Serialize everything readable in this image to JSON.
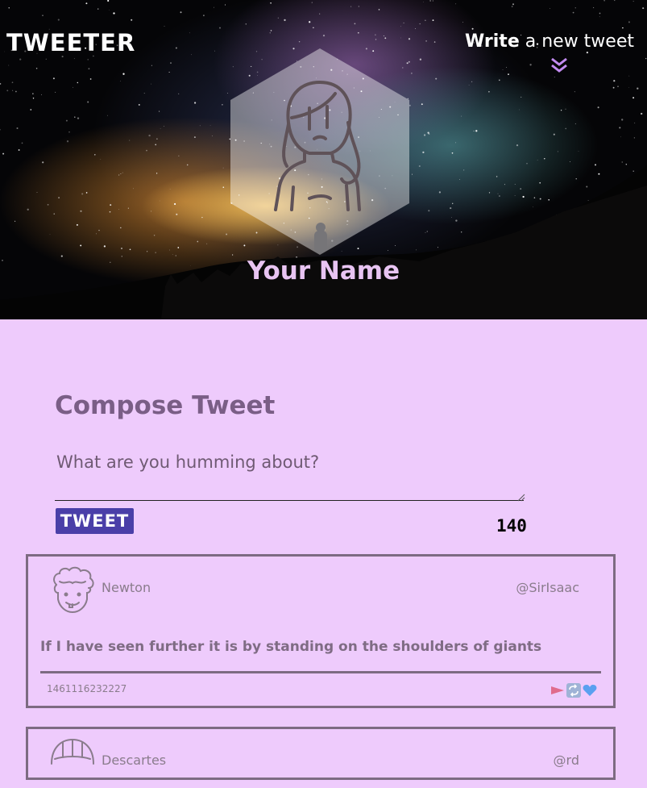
{
  "brand": "TWEETER",
  "nav": {
    "write_bold": "Write",
    "write_rest": " a new tweet",
    "chevron_icon": "double-chevron-down-icon"
  },
  "profile": {
    "name": "Your Name",
    "avatar_icon": "user-avatar-icon"
  },
  "compose": {
    "title": "Compose Tweet",
    "placeholder": "What are you humming about?",
    "button_label": "TWEET",
    "counter": "140"
  },
  "tweets": [
    {
      "name": "Newton",
      "handle": "@SirIsaac",
      "content": "If I have seen further it is by standing on the shoulders of giants",
      "timestamp": "1461116232227",
      "actions": [
        "flag-icon",
        "retweet-icon",
        "heart-icon"
      ]
    },
    {
      "name": "Descartes",
      "handle": "@rd"
    }
  ],
  "colors": {
    "accent": "#4a3fa8",
    "background": "#eecbfc",
    "border": "#7d6b82",
    "heading": "#7a5e86"
  }
}
